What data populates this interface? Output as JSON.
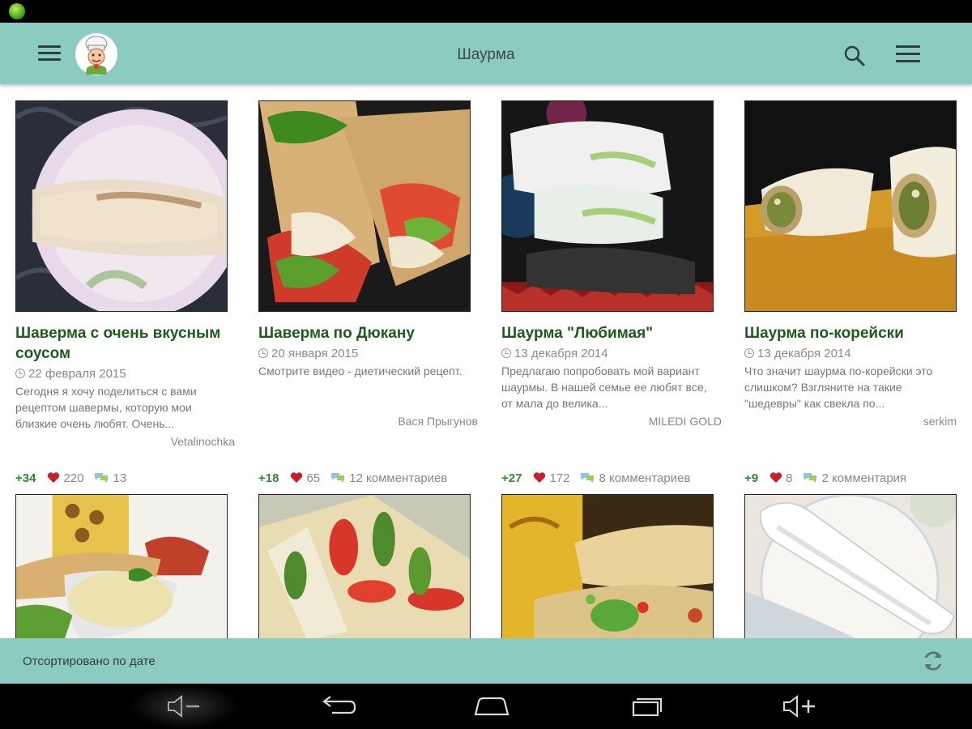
{
  "app_bar": {
    "title": "Шаурма"
  },
  "recipes": [
    {
      "title": "Шаверма с очень вкусным соусом",
      "date": "22 февраля 2015",
      "description": "Сегодня я хочу поделиться с вами рецептом шавермы, которую мои близкие очень любят. Очень...",
      "author": "Vetalinochka",
      "score": "+34",
      "likes": "220",
      "comments": "13"
    },
    {
      "title": "Шаверма по Дюкану",
      "date": "20 января 2015",
      "description": "Смотрите видео - диетический рецепт.",
      "author": "Вася Прыгунов",
      "score": "+18",
      "likes": "65",
      "comments": "12 комментариев"
    },
    {
      "title": "Шаурма \"Любимая\"",
      "date": "13 декабря 2014",
      "description": "Предлагаю попробовать мой вариант шаурмы. В нашей семье ее любят все, от мала до велика...",
      "author": "MILEDI GOLD",
      "score": "+27",
      "likes": "172",
      "comments": "8 комментариев"
    },
    {
      "title": "Шаурма по-корейски",
      "date": "13 декабря 2014",
      "description": "Что значит шаурма по-корейски это слишком? Взгляните на такие \"шедевры\" как свекла по...",
      "author": "serkim",
      "score": "+9",
      "likes": "8",
      "comments": "2 комментария"
    }
  ],
  "sort_bar": {
    "label": "Отсортировано по дате"
  },
  "icons": {
    "app_bar": [
      "hamburger-icon",
      "chef-logo-icon",
      "search-icon",
      "overflow-menu-icon"
    ],
    "sort_bar": [
      "refresh-icon"
    ],
    "nav_bar": [
      "volume-down-icon",
      "back-icon",
      "home-icon",
      "recent-apps-icon",
      "volume-up-icon"
    ]
  },
  "colors": {
    "accent": "#8ccbc0",
    "title": "#1f5a1f",
    "score": "#2f8a2f",
    "heart": "#c8202a"
  }
}
